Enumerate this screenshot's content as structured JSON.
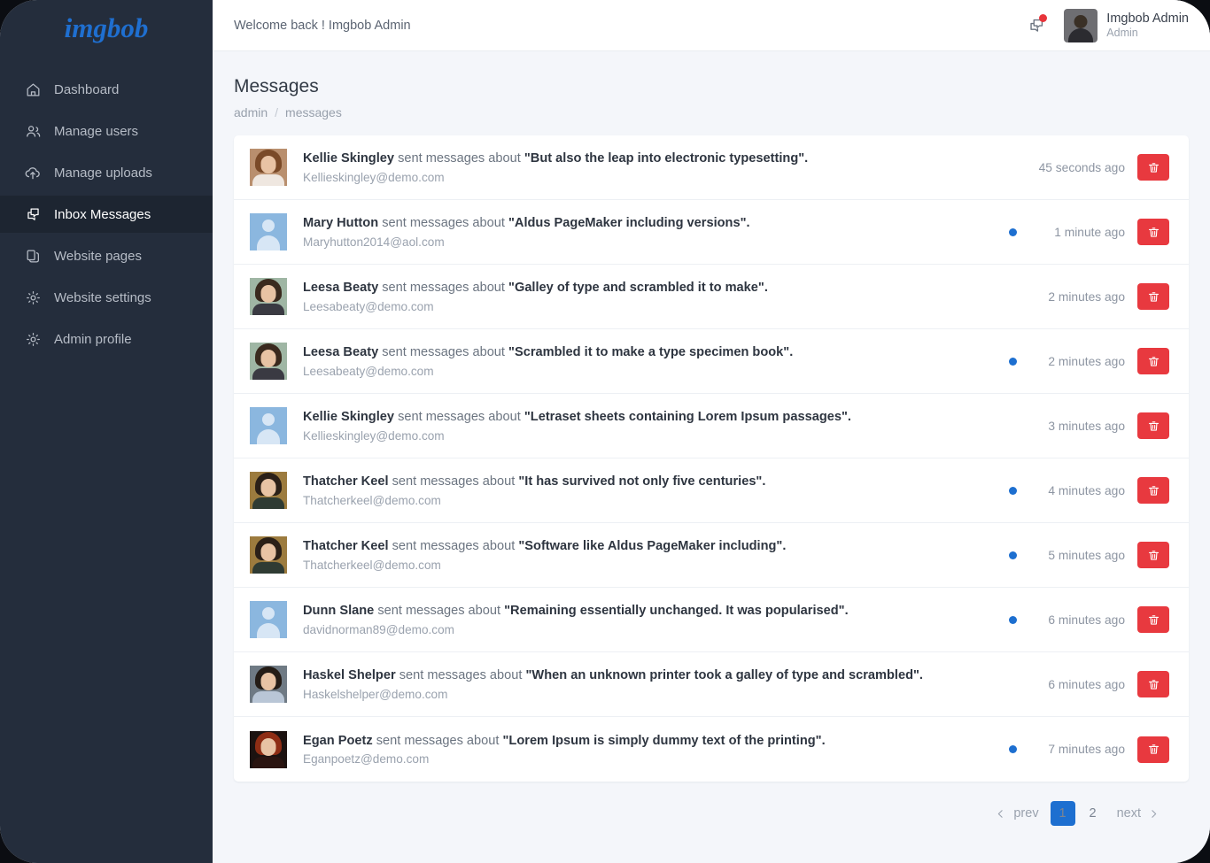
{
  "brand": {
    "logo_text": "imgbob",
    "accent_color": "#1f6fd0"
  },
  "sidebar": {
    "items": [
      {
        "label": "Dashboard",
        "icon": "home-icon",
        "active": false
      },
      {
        "label": "Manage users",
        "icon": "users-icon",
        "active": false
      },
      {
        "label": "Manage uploads",
        "icon": "cloud-upload-icon",
        "active": false
      },
      {
        "label": "Inbox Messages",
        "icon": "chat-icon",
        "active": true
      },
      {
        "label": "Website pages",
        "icon": "pages-icon",
        "active": false
      },
      {
        "label": "Website settings",
        "icon": "gear-icon",
        "active": false
      },
      {
        "label": "Admin profile",
        "icon": "gear-icon",
        "active": false
      }
    ]
  },
  "topbar": {
    "welcome": "Welcome back ! Imgbob Admin",
    "notification_icon": "chat-bubbles-icon",
    "notification_badge_color": "#e8343a",
    "user": {
      "name": "Imgbob Admin",
      "role": "Admin"
    }
  },
  "page": {
    "title": "Messages",
    "breadcrumb": {
      "root": "admin",
      "separator": "/",
      "current": "messages"
    }
  },
  "messages": [
    {
      "sender": "Kellie Skingley",
      "action": "sent messages about",
      "subject": "\"But also the leap into electronic typesetting\".",
      "email": "Kellieskingley@demo.com",
      "time": "45 seconds ago",
      "unread": false,
      "avatar": "photo-woman-blonde",
      "avatar_colors": {
        "bg": "#b98f6e",
        "hair": "#7a4a28",
        "shirt": "#efe7e0"
      },
      "delete_label": "trash-icon"
    },
    {
      "sender": "Mary Hutton",
      "action": "sent messages about",
      "subject": "\"Aldus PageMaker including versions\".",
      "email": "Maryhutton2014@aol.com",
      "time": "1 minute ago",
      "unread": true,
      "avatar": "placeholder",
      "avatar_colors": {
        "bg": "#8bb7df",
        "hair": "",
        "shirt": ""
      },
      "delete_label": "trash-icon"
    },
    {
      "sender": "Leesa Beaty",
      "action": "sent messages about",
      "subject": "\"Galley of type and scrambled it to make\".",
      "email": "Leesabeaty@demo.com",
      "time": "2 minutes ago",
      "unread": false,
      "avatar": "photo-woman-brunette",
      "avatar_colors": {
        "bg": "#9fb6a4",
        "hair": "#3a2a1e",
        "shirt": "#3a3a42"
      },
      "delete_label": "trash-icon"
    },
    {
      "sender": "Leesa Beaty",
      "action": "sent messages about",
      "subject": "\"Scrambled it to make a type specimen book\".",
      "email": "Leesabeaty@demo.com",
      "time": "2 minutes ago",
      "unread": true,
      "avatar": "photo-woman-brunette",
      "avatar_colors": {
        "bg": "#9fb6a4",
        "hair": "#3a2a1e",
        "shirt": "#3a3a42"
      },
      "delete_label": "trash-icon"
    },
    {
      "sender": "Kellie Skingley",
      "action": "sent messages about",
      "subject": "\"Letraset sheets containing Lorem Ipsum passages\".",
      "email": "Kellieskingley@demo.com",
      "time": "3 minutes ago",
      "unread": false,
      "avatar": "placeholder",
      "avatar_colors": {
        "bg": "#8bb7df",
        "hair": "",
        "shirt": ""
      },
      "delete_label": "trash-icon"
    },
    {
      "sender": "Thatcher Keel",
      "action": "sent messages about",
      "subject": "\"It has survived not only five centuries\".",
      "email": "Thatcherkeel@demo.com",
      "time": "4 minutes ago",
      "unread": true,
      "avatar": "photo-man-outdoor",
      "avatar_colors": {
        "bg": "#9c7b3e",
        "hair": "#2b2018",
        "shirt": "#2f3b33"
      },
      "delete_label": "trash-icon"
    },
    {
      "sender": "Thatcher Keel",
      "action": "sent messages about",
      "subject": "\"Software like Aldus PageMaker including\".",
      "email": "Thatcherkeel@demo.com",
      "time": "5 minutes ago",
      "unread": true,
      "avatar": "photo-man-outdoor",
      "avatar_colors": {
        "bg": "#9c7b3e",
        "hair": "#2b2018",
        "shirt": "#2f3b33"
      },
      "delete_label": "trash-icon"
    },
    {
      "sender": "Dunn Slane",
      "action": "sent messages about",
      "subject": "\"Remaining essentially unchanged. It was popularised\".",
      "email": "davidnorman89@demo.com",
      "time": "6 minutes ago",
      "unread": true,
      "avatar": "placeholder",
      "avatar_colors": {
        "bg": "#8bb7df",
        "hair": "",
        "shirt": ""
      },
      "delete_label": "trash-icon"
    },
    {
      "sender": "Haskel Shelper",
      "action": "sent messages about",
      "subject": "\"When an unknown printer took a galley of type and scrambled\".",
      "email": "Haskelshelper@demo.com",
      "time": "6 minutes ago",
      "unread": false,
      "avatar": "photo-man-indoor",
      "avatar_colors": {
        "bg": "#6f7a84",
        "hair": "#241c16",
        "shirt": "#b9c6d6"
      },
      "delete_label": "trash-icon"
    },
    {
      "sender": "Egan Poetz",
      "action": "sent messages about",
      "subject": "\"Lorem Ipsum is simply dummy text of the printing\".",
      "email": "Eganpoetz@demo.com",
      "time": "7 minutes ago",
      "unread": true,
      "avatar": "photo-woman-red",
      "avatar_colors": {
        "bg": "#1c1210",
        "hair": "#8e2d14",
        "shirt": "#2a1410"
      },
      "delete_label": "trash-icon"
    }
  ],
  "pagination": {
    "prev_label": "prev",
    "next_label": "next",
    "pages": [
      "1",
      "2"
    ],
    "active_page": "1",
    "active_color": "#1d6fd0"
  }
}
